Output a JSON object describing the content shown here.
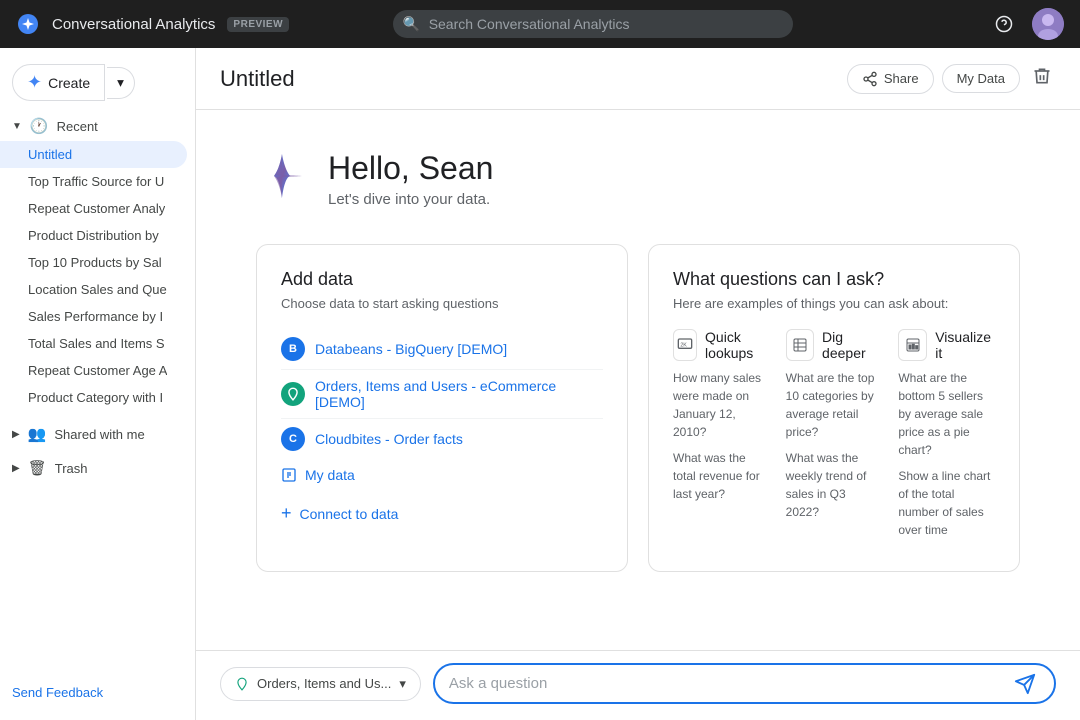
{
  "topbar": {
    "app_name": "Conversational Analytics",
    "preview_label": "PREVIEW",
    "search_placeholder": "Search Conversational Analytics"
  },
  "sidebar": {
    "create_label": "Create",
    "recent_label": "Recent",
    "shared_label": "Shared with me",
    "trash_label": "Trash",
    "send_feedback_label": "Send Feedback",
    "items": [
      {
        "id": "untitled",
        "label": "Untitled",
        "active": true
      },
      {
        "id": "top-traffic",
        "label": "Top Traffic Source for U",
        "active": false
      },
      {
        "id": "repeat-customer",
        "label": "Repeat Customer Analy",
        "active": false
      },
      {
        "id": "product-distribution",
        "label": "Product Distribution by",
        "active": false
      },
      {
        "id": "top-10-products",
        "label": "Top 10 Products by Sal",
        "active": false
      },
      {
        "id": "location-sales",
        "label": "Location Sales and Que",
        "active": false
      },
      {
        "id": "sales-performance",
        "label": "Sales Performance by I",
        "active": false
      },
      {
        "id": "total-sales",
        "label": "Total Sales and Items S",
        "active": false
      },
      {
        "id": "repeat-customer-age",
        "label": "Repeat Customer Age A",
        "active": false
      },
      {
        "id": "product-category",
        "label": "Product Category with I",
        "active": false
      }
    ]
  },
  "page": {
    "title": "Untitled",
    "share_label": "Share",
    "my_data_label": "My Data"
  },
  "greeting": {
    "title": "Hello, Sean",
    "subtitle": "Let's dive into your data."
  },
  "add_data_card": {
    "title": "Add data",
    "subtitle": "Choose data to start asking questions",
    "items": [
      {
        "id": "databeans",
        "label": "Databeans - BigQuery [DEMO]",
        "color": "blue"
      },
      {
        "id": "orders",
        "label": "Orders, Items and Users - eCommerce [DEMO]",
        "color": "teal"
      },
      {
        "id": "cloudbites",
        "label": "Cloudbites - Order facts",
        "color": "blue"
      }
    ],
    "my_data_label": "My data",
    "connect_label": "Connect to data"
  },
  "questions_card": {
    "title": "What questions can I ask?",
    "subtitle": "Here are examples of things you can ask about:",
    "categories": [
      {
        "id": "quick-lookups",
        "icon": "🔍",
        "title": "Quick lookups",
        "examples": [
          "How many sales were made on January 12, 2010?",
          "What was the total revenue for last year?"
        ]
      },
      {
        "id": "dig-deeper",
        "icon": "📋",
        "title": "Dig deeper",
        "examples": [
          "What are the top 10 categories by average retail price?",
          "What was the weekly trend of sales in Q3 2022?"
        ]
      },
      {
        "id": "visualize-it",
        "icon": "📊",
        "title": "Visualize it",
        "examples": [
          "What are the bottom 5 sellers by average sale price as a pie chart?",
          "Show a line chart of the total number of sales over time"
        ]
      }
    ]
  },
  "bottom_bar": {
    "data_selector_label": "Orders, Items and Us...",
    "ask_placeholder": "Ask a question"
  }
}
